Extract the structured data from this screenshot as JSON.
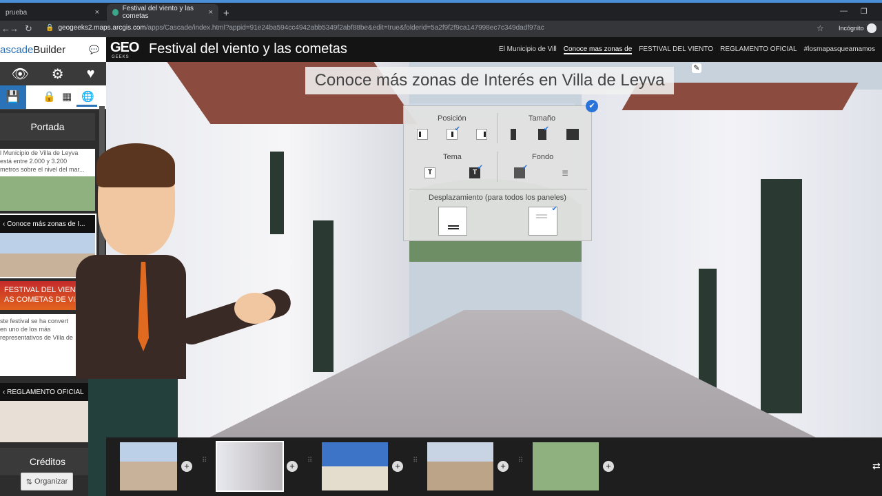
{
  "browser": {
    "tabs": [
      {
        "label": "prueba"
      },
      {
        "label": "Festival del viento y las cometas"
      }
    ],
    "close_glyph": "×",
    "new_tab": "+",
    "url_host": "geogeeks2.maps.arcgis.com",
    "url_path": "/apps/Cascade/index.html?appid=91e24ba594cc4942abb5349f2abf88be&edit=true&folderid=5a2f9f2f9ca147998ec7c349dadf97ac",
    "incognito_label": "Incógnito"
  },
  "sidebar": {
    "title_prefix": "ascade",
    "title_suffix": " Builder",
    "sections": [
      {
        "head": "Portada",
        "text_lines": [
          "l Municipio de Villa de Leyva",
          "está entre 2.000 y 3.200",
          "metros sobre el nivel del mar..."
        ]
      },
      {
        "label": "Conoce más zonas de I..."
      },
      {
        "banner_lines": [
          "FESTIVAL DEL VIENTO Y",
          "AS COMETAS DE VILLA"
        ],
        "text_lines": [
          "ste festival se ha convert",
          "en uno de los más",
          "representativos de Villa de"
        ]
      },
      {
        "label": "REGLAMENTO OFICIAL"
      },
      {
        "head": "Créditos"
      }
    ],
    "organize_label": "Organizar"
  },
  "header": {
    "logo": "GEO",
    "logo_sub": "GEEKS",
    "title": "Festival del viento y las cometas",
    "nav": [
      {
        "label": "El Municipio de Vill",
        "active": false
      },
      {
        "label": "Conoce mas zonas de",
        "active": true
      },
      {
        "label": "FESTIVAL DEL VIENTO",
        "active": false
      },
      {
        "label": "REGLAMENTO OFICIAL",
        "active": false
      },
      {
        "label": "#losmapasqueamamos",
        "active": false
      }
    ]
  },
  "scene": {
    "heading": "Conoce más zonas de Interés en Villa de Leyva"
  },
  "popup": {
    "position_label": "Posición",
    "size_label": "Tamaño",
    "theme_label": "Tema",
    "background_label": "Fondo",
    "scroll_label": "Desplazamiento (para todos los paneles)",
    "theme_glyph": "T"
  },
  "colors": {
    "accent": "#2a73b8",
    "check": "#2a73d8",
    "header_bg": "#141414",
    "tie": "#e06a20"
  }
}
